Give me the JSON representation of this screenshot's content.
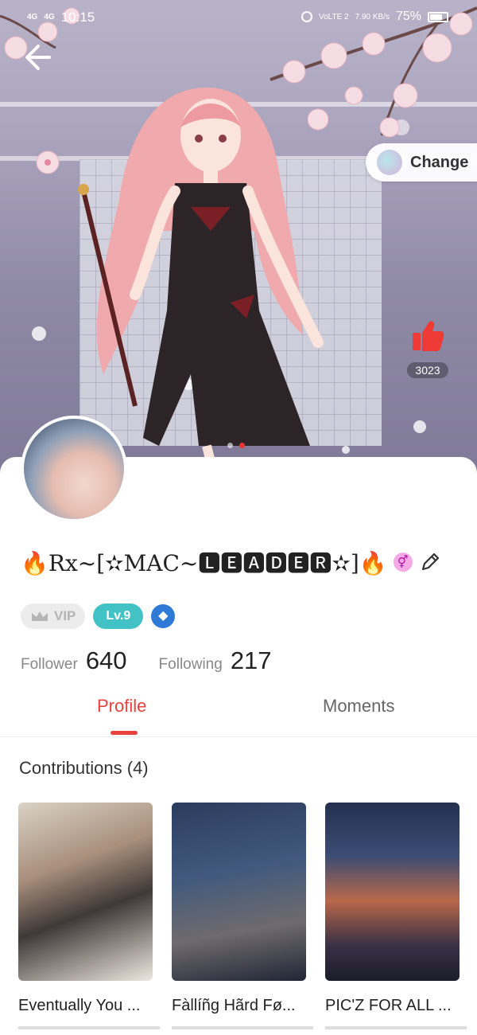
{
  "status_bar": {
    "network_1": "4G",
    "network_2": "4G",
    "time": "10:15",
    "volte": "VoLTE 2",
    "speed": "7.90 KB/s",
    "battery": "75%"
  },
  "header": {
    "change_label": "Change"
  },
  "likes": {
    "count": "3023"
  },
  "carousel": {
    "total": 2,
    "active_index": 1
  },
  "profile": {
    "username": "🔥Rx~[✫MAC~🅻🅴🅰🅳🅴🆁✫]🔥",
    "gender_symbol": "⚥",
    "vip_label": "VIP",
    "level_label": "Lv.9",
    "follower_label": "Follower",
    "follower_count": "640",
    "following_label": "Following",
    "following_count": "217"
  },
  "tabs": {
    "profile": "Profile",
    "moments": "Moments",
    "active": "Profile"
  },
  "contributions": {
    "title": "Contributions (4)",
    "items": [
      {
        "title": "Eventually You ..."
      },
      {
        "title": "Fàllíñg Hãrd Fø..."
      },
      {
        "title": "PIC'Z FOR ALL ..."
      }
    ]
  },
  "colors": {
    "accent": "#e8413e",
    "level_badge": "#42c2c4",
    "like": "#ee3b36"
  },
  "icons": [
    "back-arrow-icon",
    "thumbs-up-icon",
    "edit-pencil-icon",
    "gender-icon",
    "crown-icon",
    "diamond-icon",
    "alarm-icon",
    "battery-icon"
  ]
}
